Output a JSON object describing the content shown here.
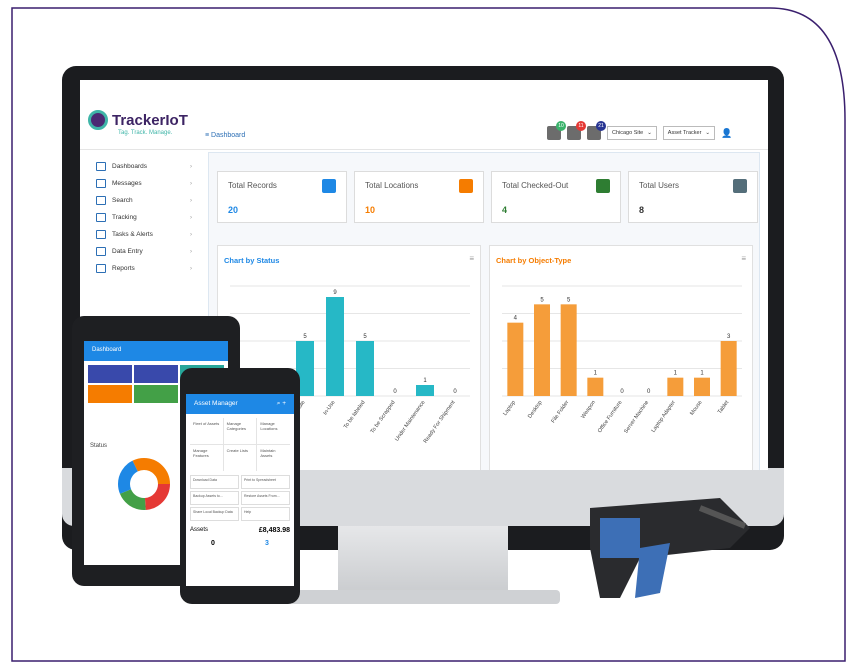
{
  "app": {
    "logo": "TrackerIoT",
    "tagline": "Tag. Track. Manage.",
    "breadcrumb": "Dashboard"
  },
  "header": {
    "badges": [
      {
        "count": "10",
        "color": "#3ab36b"
      },
      {
        "count": "11",
        "color": "#e53935"
      },
      {
        "count": "21",
        "color": "#283593"
      }
    ],
    "site": "Chicago Site",
    "app_select": "Asset Tracker"
  },
  "sidebar": {
    "items": [
      {
        "label": "Dashboards",
        "icon": "dashboard-icon"
      },
      {
        "label": "Messages",
        "icon": "mail-icon"
      },
      {
        "label": "Search",
        "icon": "search-icon"
      },
      {
        "label": "Tracking",
        "icon": "tracking-icon"
      },
      {
        "label": "Tasks & Alerts",
        "icon": "tasks-icon"
      },
      {
        "label": "Data Entry",
        "icon": "edit-icon"
      },
      {
        "label": "Reports",
        "icon": "folder-icon"
      }
    ]
  },
  "cards": [
    {
      "label": "Total Records",
      "value": "20",
      "color": "#1e88e5",
      "icon": "database-icon"
    },
    {
      "label": "Total Locations",
      "value": "10",
      "color": "#f57c00",
      "icon": "location-icon"
    },
    {
      "label": "Total Checked-Out",
      "value": "4",
      "color": "#2e7d32",
      "icon": "checkout-icon"
    },
    {
      "label": "Total Users",
      "value": "8",
      "color": "#546e7a",
      "icon": "user-icon"
    }
  ],
  "chart_data": [
    {
      "type": "bar",
      "title": "Chart by Status",
      "color": "#26b8c6",
      "categories": [
        "",
        "",
        "Idle",
        "In-Use",
        "To be labeled",
        "To be Scrapped",
        "Under Maintenance",
        "Ready For Shipment"
      ],
      "values": [
        0,
        0,
        5,
        9,
        5,
        0,
        1,
        0
      ],
      "ylim": [
        0,
        10
      ]
    },
    {
      "type": "bar",
      "title": "Chart by Object-Type",
      "color": "#f59d3a",
      "categories": [
        "Laptop",
        "Desktop",
        "File Folder",
        "Weapon",
        "Office Furniture",
        "Server Machine",
        "Laptop Adapter",
        "Mouse",
        "Tablet"
      ],
      "values": [
        4,
        5,
        5,
        1,
        0,
        0,
        1,
        1,
        3
      ],
      "ylim": [
        0,
        6
      ]
    }
  ],
  "phone": {
    "title": "Asset Manager",
    "tiles": [
      "Fleet of Assets",
      "Manage Categories",
      "Manage Locations",
      "Manage Features",
      "Create Lists",
      "Maintain Assets"
    ],
    "buttons": [
      "Download Data",
      "Print to Spreadsheet",
      "Backup Assets to...",
      "Restore Assets From...",
      "Share Local Backup Data",
      "Help"
    ],
    "assets_label": "Assets",
    "assets_value": "£8,483.98",
    "stat1": "0",
    "stat2": "3"
  },
  "tablet": {
    "title": "Dashboard",
    "section": "Status"
  }
}
